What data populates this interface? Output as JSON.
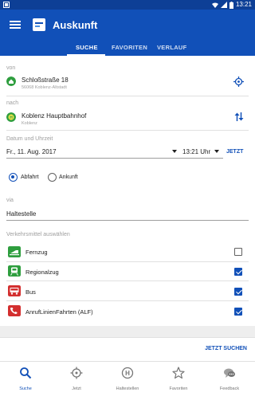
{
  "status_bar": {
    "time": "13:21"
  },
  "app_bar": {
    "title": "Auskunft"
  },
  "tabs": [
    {
      "label": "SUCHE",
      "active": true
    },
    {
      "label": "FAVORITEN",
      "active": false
    },
    {
      "label": "VERLAUF",
      "active": false
    }
  ],
  "from": {
    "label": "von",
    "main": "Schloßstraße 18",
    "sub": "56068 Koblenz-Altstadt"
  },
  "to": {
    "label": "nach",
    "main": "Koblenz Hauptbahnhof",
    "sub": "Koblenz"
  },
  "datetime": {
    "label": "Datum und Uhrzeit",
    "date": "Fr., 11. Aug. 2017",
    "time": "13:21 Uhr",
    "now_button": "JETZT"
  },
  "mode": {
    "departure": "Abfahrt",
    "arrival": "Ankunft",
    "selected": "departure"
  },
  "via": {
    "label": "via",
    "value": "Haltestelle"
  },
  "transport": {
    "label": "Verkehrsmittel auswählen",
    "items": [
      {
        "label": "Fernzug",
        "checked": false,
        "color": "#2e9e3e"
      },
      {
        "label": "Regionalzug",
        "checked": true,
        "color": "#2e9e3e"
      },
      {
        "label": "Bus",
        "checked": true,
        "color": "#d32f2f"
      },
      {
        "label": "AnrufLinienFahrten (ALF)",
        "checked": true,
        "color": "#d32f2f"
      }
    ]
  },
  "search_button": "JETZT SUCHEN",
  "bottom_nav": [
    {
      "label": "Suche",
      "icon": "search-icon",
      "active": true
    },
    {
      "label": "Jetzt",
      "icon": "crosshair-icon",
      "active": false
    },
    {
      "label": "Haltestellen",
      "icon": "bus-stop-icon",
      "active": false
    },
    {
      "label": "Favoriten",
      "icon": "star-icon",
      "active": false
    },
    {
      "label": "Feedback",
      "icon": "feedback-icon",
      "active": false
    }
  ],
  "colors": {
    "primary": "#1150b8",
    "status_bar": "#0d3f96",
    "accent_green": "#2e9e3e",
    "accent_red": "#d32f2f"
  }
}
